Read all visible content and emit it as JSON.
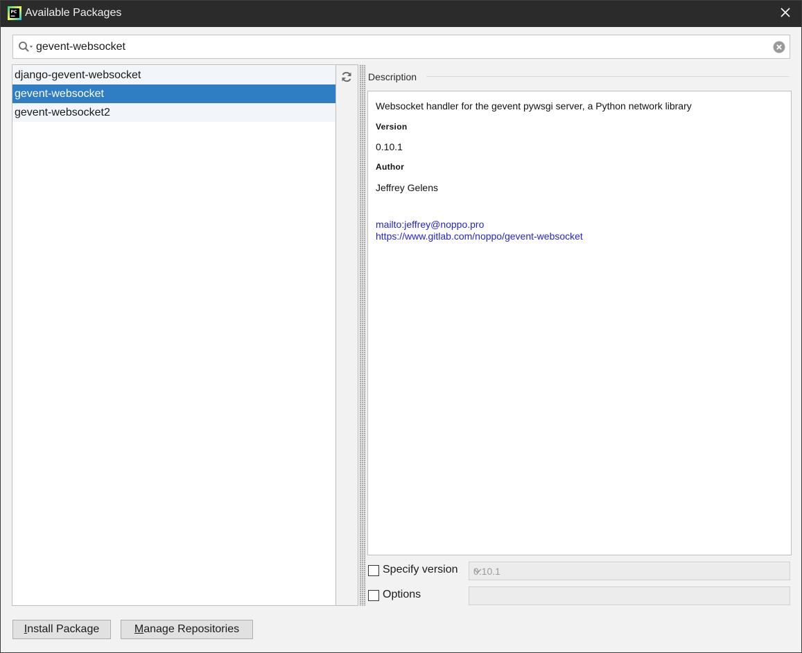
{
  "window": {
    "title": "Available Packages"
  },
  "search": {
    "value": "gevent-websocket"
  },
  "packages": [
    {
      "name": "django-gevent-websocket"
    },
    {
      "name": "gevent-websocket",
      "selected": true
    },
    {
      "name": "gevent-websocket2"
    }
  ],
  "description": {
    "label": "Description",
    "summary": "Websocket handler for the gevent pywsgi server, a Python network library",
    "version_heading": "Version",
    "version": "0.10.1",
    "author_heading": "Author",
    "author": "Jeffrey Gelens",
    "email_link": "mailto:jeffrey@noppo.pro",
    "url_link": "https://www.gitlab.com/noppo/gevent-websocket"
  },
  "options": {
    "specify_version_label": "Specify version",
    "specify_version_checked": false,
    "version_value": "0.10.1",
    "options_label": "Options",
    "options_checked": false,
    "options_value": ""
  },
  "buttons": {
    "install_mnemonic": "I",
    "install_rest": "nstall Package",
    "manage_mnemonic": "M",
    "manage_rest": "anage Repositories"
  },
  "icons": {
    "app": "pycharm-icon",
    "close": "close-icon",
    "search": "search-icon",
    "clear": "clear-icon",
    "refresh": "refresh-icon",
    "dropdown": "chevron-down-icon"
  },
  "colors": {
    "titlebar": "#2b2b2b",
    "selection": "#2f7dc3",
    "link": "#2424cc"
  }
}
